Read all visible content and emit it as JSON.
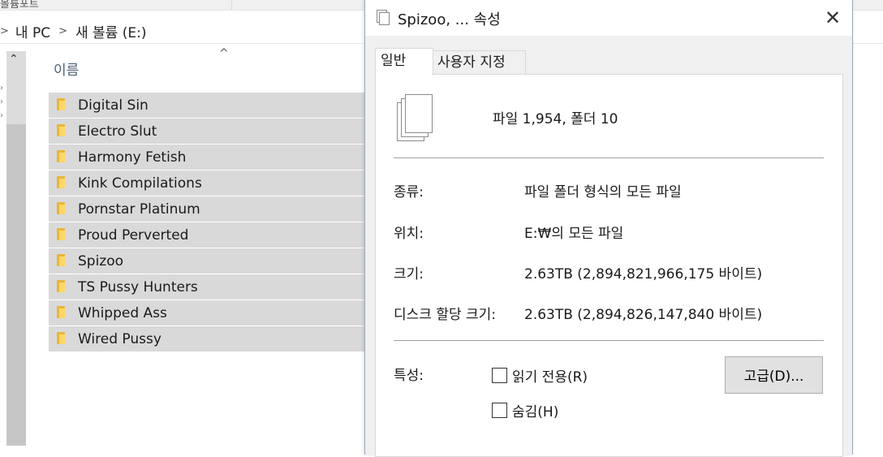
{
  "explorer": {
    "top_strip_text": "볼륨포트",
    "address": {
      "pc": "내 PC",
      "drive": "새 볼륨 (E:)"
    },
    "column_header": "이름",
    "sort_caret": "^",
    "folders": [
      "Digital Sin",
      "Electro Slut",
      "Harmony Fetish",
      "Kink Compilations",
      "Pornstar Platinum",
      "Proud Perverted",
      "Spizoo",
      "TS Pussy Hunters",
      "Whipped Ass",
      "Wired Pussy"
    ]
  },
  "dialog": {
    "title": "Spizoo, ... 속성",
    "close": "✕",
    "tabs": [
      "일반",
      "사용자 지정"
    ],
    "summary": "파일 1,954, 폴더 10",
    "type_label": "종류:",
    "type_value": "파일 폴더 형식의 모든 파일",
    "location_label": "위치:",
    "location_value": "E:₩의 모든 파일",
    "size_label": "크기:",
    "size_value": "2.63TB (2,894,821,966,175 바이트)",
    "disk_size_label": "디스크 할당 크기:",
    "disk_size_value": "2.63TB (2,894,826,147,840 바이트)",
    "attributes_label": "특성:",
    "readonly_label": "읽기 전용(R)",
    "hidden_label": "숨김(H)",
    "advanced_button": "고급(D)..."
  },
  "colors": {
    "selection": "#d9d9d9",
    "dialog_bg": "#f0f0f0",
    "header_text": "#4c607a"
  }
}
